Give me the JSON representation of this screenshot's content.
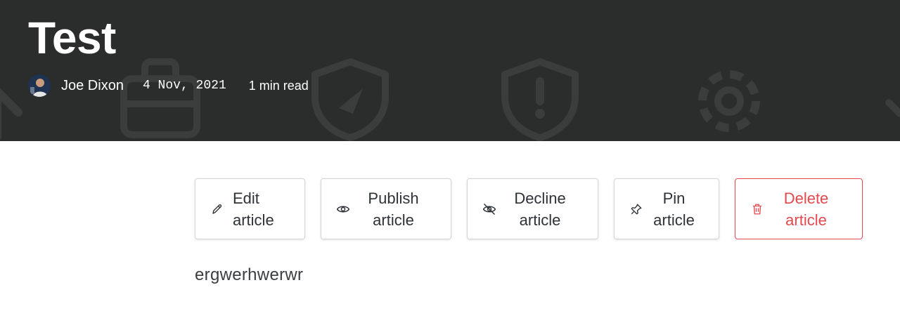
{
  "article": {
    "title": "Test",
    "author": "Joe Dixon",
    "date": "4 Nov, 2021",
    "read_time": "1 min read",
    "body": "ergwerhwerwr"
  },
  "actions": [
    {
      "label_line1": "Edit",
      "label_line2": "article",
      "icon": "pencil-icon"
    },
    {
      "label_line1": "Publish",
      "label_line2": "article",
      "icon": "eye-icon"
    },
    {
      "label_line1": "Decline",
      "label_line2": "article",
      "icon": "eye-off-icon"
    },
    {
      "label_line1": "Pin",
      "label_line2": "article",
      "icon": "pin-icon"
    },
    {
      "label_line1": "Delete",
      "label_line2": "article",
      "icon": "trash-icon"
    }
  ],
  "colors": {
    "hero_bg": "#2b2c2c",
    "danger": "#e5484d",
    "button_border": "#d3d5d8"
  },
  "background_icons": [
    "arrow-icon",
    "briefcase-icon",
    "shield-check-icon",
    "shield-alert-icon",
    "gear-icon",
    "chevron-icon"
  ]
}
